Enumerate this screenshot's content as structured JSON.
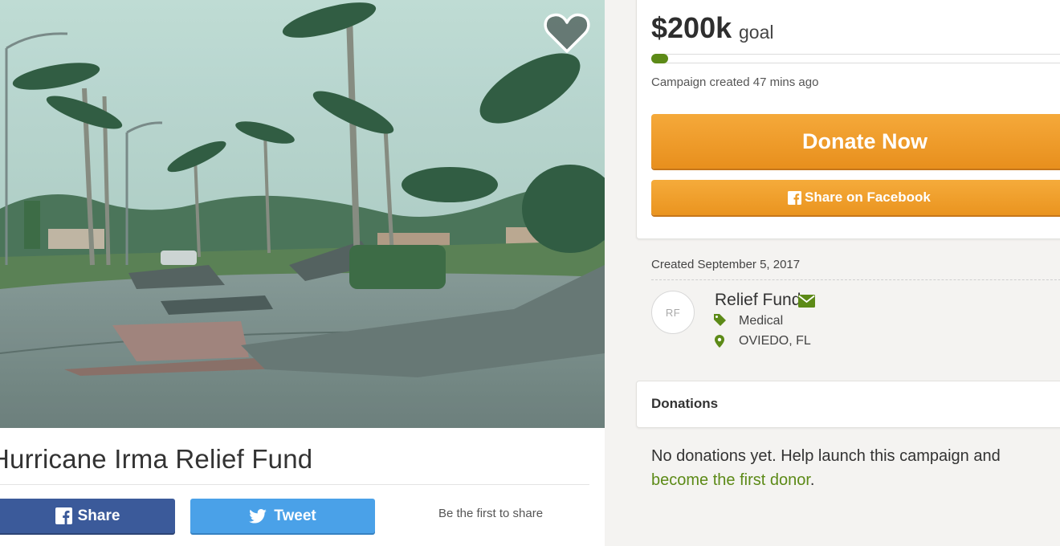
{
  "campaign": {
    "title": "Hurricane Irma Relief Fund",
    "goal_amount": "$200k",
    "goal_word": "goal",
    "progress_fraction": 0.04,
    "created_ago": "Campaign created 47 mins ago",
    "created_date": "Created September 5, 2017"
  },
  "actions": {
    "donate_label": "Donate Now",
    "share_facebook_label": "Share on Facebook",
    "share_label": "Share",
    "tweet_label": "Tweet",
    "first_share_text": "Be the first to share"
  },
  "organizer": {
    "initials": "RF",
    "name": "Relief Fund",
    "category": "Medical",
    "location": "OVIEDO, FL"
  },
  "donations": {
    "title": "Donations",
    "empty_text": "No donations yet. Help launch this campaign and ",
    "empty_link": "become the first donor",
    "empty_end": "."
  },
  "colors": {
    "facebook_blue": "#3b5a9a",
    "twitter_blue": "#4aa1e8",
    "donate_orange": "#f0a030",
    "progress_green": "#5c8a17",
    "link_green": "#5c8a17"
  },
  "icons": {
    "heart": "heart-icon",
    "facebook": "facebook-icon",
    "twitter": "twitter-icon",
    "envelope": "envelope-icon",
    "tag": "tag-icon",
    "pin": "map-pin-icon"
  }
}
